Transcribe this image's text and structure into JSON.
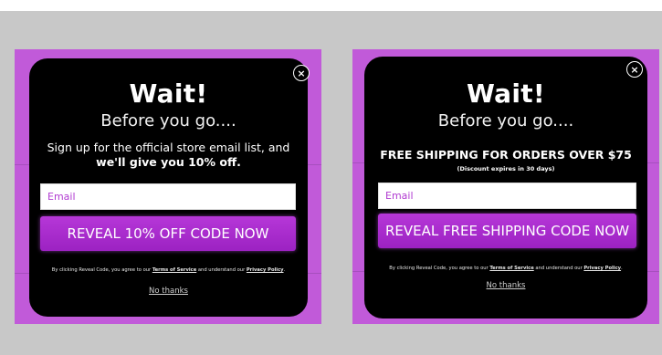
{
  "left": {
    "close_glyph": "×",
    "title": "Wait!",
    "subtitle": "Before you go....",
    "offer_line1": "Sign up for the official store email list, and",
    "offer_line2": "we'll give you 10% off.",
    "email_placeholder": "Email",
    "cta_label": "REVEAL 10% OFF CODE NOW",
    "legal_prefix": "By clicking Reveal Code, you agree to our ",
    "legal_terms": "Terms of Service",
    "legal_middle": " and understand our ",
    "legal_privacy": "Privacy Policy",
    "legal_suffix": ".",
    "no_thanks": "No thanks"
  },
  "right": {
    "close_glyph": "×",
    "title": "Wait!",
    "subtitle": "Before you go....",
    "offer_headline": "FREE SHIPPING FOR ORDERS OVER $75",
    "offer_expiry": "(Discount expires in 30 days)",
    "email_placeholder": "Email",
    "cta_label": "REVEAL FREE SHIPPING CODE NOW",
    "legal_prefix": "By clicking Reveal Code, you agree to our ",
    "legal_terms": "Terms of Service",
    "legal_middle": " and understand our ",
    "legal_privacy": "Privacy Policy",
    "legal_suffix": ".",
    "no_thanks": "No thanks"
  },
  "colors": {
    "frame": "#c15ad9",
    "cta": "#a92ccd",
    "popup": "#000000",
    "placeholder": "#b13bd1"
  }
}
